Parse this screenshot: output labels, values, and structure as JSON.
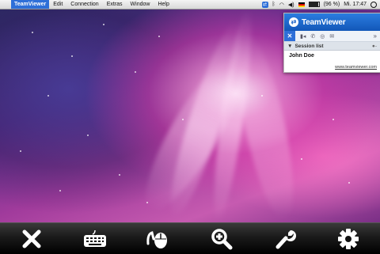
{
  "menubar": {
    "apple_glyph": "",
    "app_name": "TeamViewer",
    "menus": [
      "Edit",
      "Connection",
      "Extras",
      "Window",
      "Help"
    ],
    "battery_text": "(96 %)",
    "clock": "Mi. 17:47"
  },
  "teamviewer_panel": {
    "brand": "TeamViewer",
    "section_title": "Session list",
    "sessions": [
      "John Doe"
    ],
    "footer_link": "www.teamviewer.com"
  },
  "toolbar": {
    "buttons": [
      {
        "icon": "close-icon"
      },
      {
        "icon": "keyboard-icon"
      },
      {
        "icon": "mouse-gesture-icon"
      },
      {
        "icon": "zoom-in-icon"
      },
      {
        "icon": "wrench-icon"
      },
      {
        "icon": "gear-icon"
      }
    ]
  },
  "colors": {
    "menubar_accent": "#2e6fd8",
    "toolbar_bg": "#000000",
    "toolbar_icon": "#ffffff"
  }
}
